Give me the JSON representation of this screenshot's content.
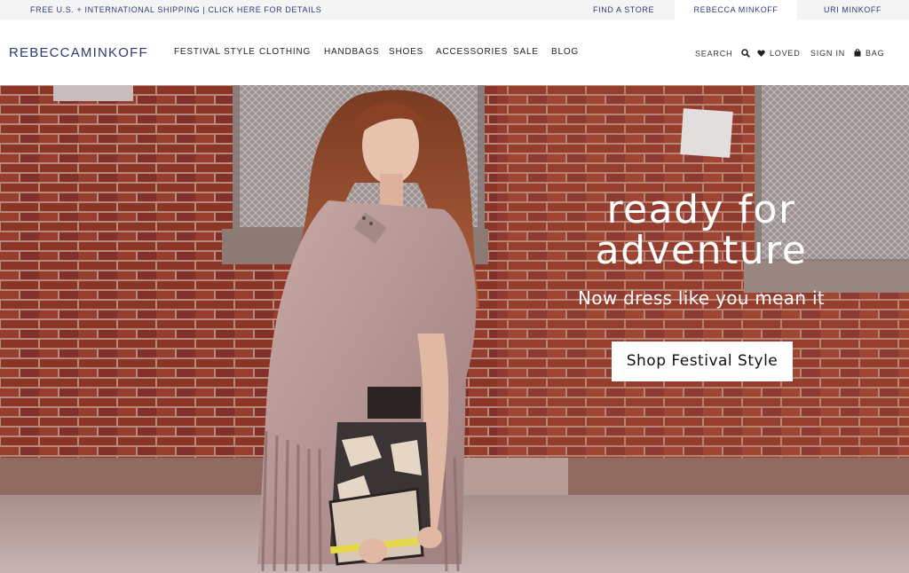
{
  "topbar": {
    "promo": "FREE U.S. + INTERNATIONAL SHIPPING | CLICK HERE FOR DETAILS",
    "find_store": "FIND A STORE",
    "brand_tab": "REBECCA MINKOFF",
    "uri_tab": "URI MINKOFF"
  },
  "header": {
    "logo_part1": "REBECCA",
    "logo_part2": "MINKOFF",
    "nav": [
      "FESTIVAL STYLE",
      "CLOTHING",
      "HANDBAGS",
      "SHOES",
      "ACCESSORIES",
      "SALE",
      "BLOG"
    ],
    "utility": {
      "search": "SEARCH",
      "loved": "LOVED",
      "sign_in": "SIGN IN",
      "bag": "BAG"
    },
    "icons": {
      "search": "search-icon",
      "loved": "heart-icon",
      "bag": "shopping-bag-icon"
    }
  },
  "hero": {
    "headline_line1": "ready for",
    "headline_line2": "adventure",
    "subheadline": "Now dress like you mean it",
    "cta_label": "Shop Festival Style"
  },
  "colors": {
    "brand_navy": "#2c3a6e",
    "brick": "#8a3a2c",
    "mortar": "#b58b7c",
    "cta_bg": "#ffffff"
  }
}
